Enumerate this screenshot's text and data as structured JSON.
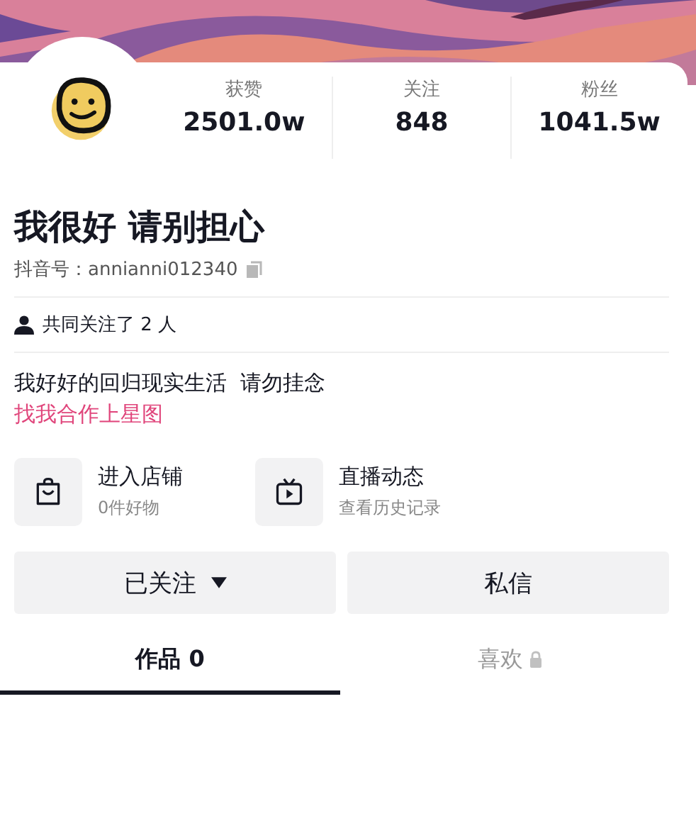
{
  "stats": [
    {
      "label": "获赞",
      "value": "2501.0w"
    },
    {
      "label": "关注",
      "value": "848"
    },
    {
      "label": "粉丝",
      "value": "1041.5w"
    }
  ],
  "profile": {
    "name": "我很好 请别担心",
    "account_id": "抖音号：annianni012340",
    "mutual_follow": "共同关注了 2 人",
    "bio": "我好好的回归现实生活  请勿挂念",
    "link": "找我合作上星图"
  },
  "shortcuts": [
    {
      "kind": "shop",
      "title": "进入店铺",
      "subtitle": "0件好物"
    },
    {
      "kind": "live",
      "title": "直播动态",
      "subtitle": "查看历史记录"
    }
  ],
  "actions": [
    {
      "kind": "followed",
      "label": "已关注"
    },
    {
      "kind": "message",
      "label": "私信"
    }
  ],
  "tabs": [
    {
      "label": "作品 0",
      "selected": true,
      "locked": false
    },
    {
      "label": "喜欢",
      "selected": false,
      "locked": true
    }
  ]
}
